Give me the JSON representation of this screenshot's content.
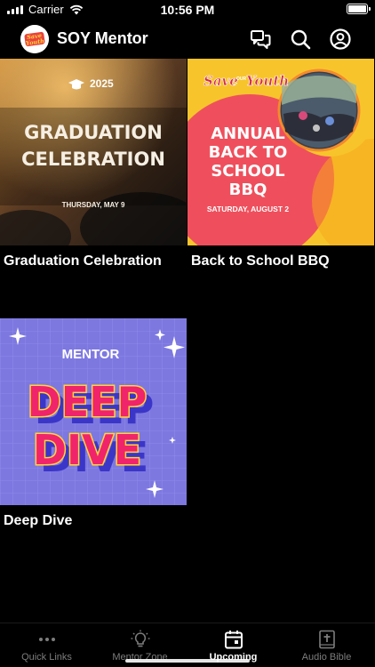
{
  "status_bar": {
    "carrier": "Carrier",
    "time": "10:56 PM"
  },
  "header": {
    "title": "SOY Mentor",
    "logo_text": "Save Our Youth"
  },
  "events": [
    {
      "title": "Graduation Celebration",
      "art": {
        "year": "2025",
        "heading_1": "GRADUATION",
        "heading_2": "CELEBRATION",
        "date": "THURSDAY, MAY 9"
      }
    },
    {
      "title": "Back to School BBQ",
      "art": {
        "brand_1": "Save",
        "brand_2": "OUR",
        "brand_3": "Youth",
        "heading_1": "ANNUAL",
        "heading_2": "BACK TO",
        "heading_3": "SCHOOL",
        "heading_4": "BBQ",
        "date": "SATURDAY, AUGUST 2"
      }
    },
    {
      "title": "Deep Dive",
      "art": {
        "kicker": "MENTOR",
        "heading_1": "DEEP",
        "heading_2": "DIVE"
      }
    }
  ],
  "tabs": [
    {
      "label": "Quick Links",
      "icon": "more-dots-icon",
      "active": false
    },
    {
      "label": "Mentor Zone",
      "icon": "lightbulb-icon",
      "active": false
    },
    {
      "label": "Upcoming",
      "icon": "calendar-icon",
      "active": true
    },
    {
      "label": "Audio Bible",
      "icon": "bible-icon",
      "active": false
    }
  ],
  "colors": {
    "background": "#000000",
    "inactive_tab": "#7d7d7d",
    "bbq_yellow": "#f7c52b",
    "bbq_red": "#ef4f5c",
    "deep_purple": "#7d78e0",
    "deep_pink": "#f0246b",
    "deep_yellow": "#ffd43b"
  }
}
